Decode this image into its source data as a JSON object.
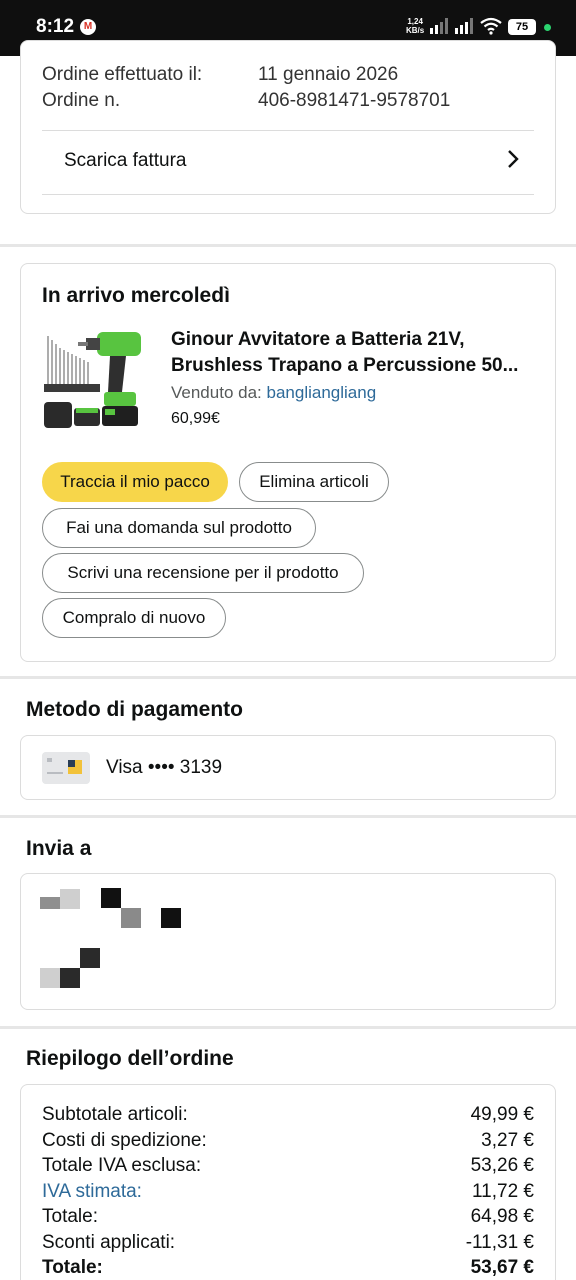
{
  "status_bar": {
    "time": "8:12",
    "speed_value": "1,24",
    "speed_unit": "KB/s",
    "battery": "75",
    "icons": [
      "gmail-icon",
      "signal-icon",
      "wifi-icon",
      "battery-icon"
    ]
  },
  "order_info": {
    "placed_label": "Ordine effettuato il:",
    "placed_value": "11 gennaio 2026",
    "number_label": "Ordine n.",
    "number_value": "406-8981471-9578701",
    "invoice_label": "Scarica fattura"
  },
  "shipment": {
    "title": "In arrivo mercoledì",
    "product": {
      "title_line1": "Ginour Avvitatore a Batteria 21V,",
      "title_line2": "Brushless Trapano a Percussione 50...",
      "seller_label": "Venduto da:",
      "seller_name": "bangliangliang",
      "price": "60,99€"
    },
    "buttons": {
      "track": "Traccia il mio pacco",
      "delete": "Elimina articoli",
      "question": "Fai una domanda sul prodotto",
      "review": "Scrivi una recensione per il prodotto",
      "rebuy": "Compralo di nuovo"
    }
  },
  "payment": {
    "title": "Metodo di pagamento",
    "method": "Visa •••• 3139"
  },
  "shipping": {
    "title": "Invia a"
  },
  "summary": {
    "title": "Riepilogo dell’ordine",
    "rows": [
      {
        "label": "Subtotale articoli:",
        "value": "49,99 €"
      },
      {
        "label": "Costi di spedizione:",
        "value": "3,27 €"
      },
      {
        "label": "Totale IVA esclusa:",
        "value": "53,26 €"
      },
      {
        "label": "IVA stimata:",
        "value": "11,72 €"
      },
      {
        "label": "Totale:",
        "value": "64,98 €"
      },
      {
        "label": "Sconti applicati:",
        "value": "-11,31 €"
      },
      {
        "label": "Totale:",
        "value": "53,67 €"
      }
    ]
  },
  "colors": {
    "primary_button": "#f7d64a",
    "link": "#2e6a99"
  }
}
